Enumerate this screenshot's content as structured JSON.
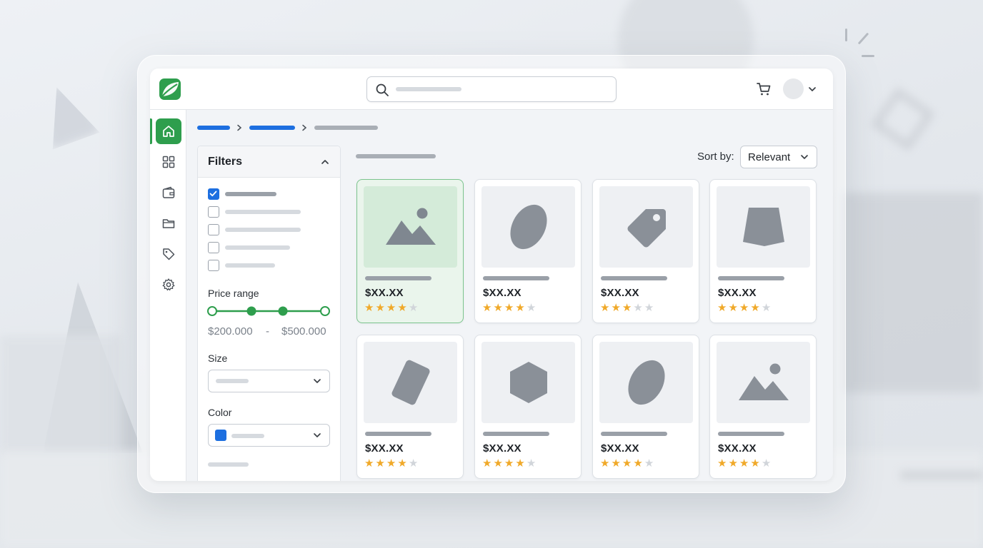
{
  "filters": {
    "title": "Filters",
    "checkboxes": [
      {
        "checked": true
      },
      {
        "checked": false
      },
      {
        "checked": false
      },
      {
        "checked": false
      },
      {
        "checked": false
      }
    ],
    "price_range": {
      "label": "Price range",
      "min": "$200.000",
      "separator": "-",
      "max": "$500.000"
    },
    "size": {
      "label": "Size"
    },
    "color": {
      "label": "Color",
      "swatch": "#1d6fe0"
    }
  },
  "sort": {
    "label": "Sort by:",
    "value": "Relevant"
  },
  "icons": {
    "sidebar": [
      "home-icon",
      "grid-icon",
      "wallet-icon",
      "folder-icon",
      "tag-icon",
      "gear-icon"
    ],
    "header": [
      "search-icon",
      "cart-icon",
      "chevron-down-icon"
    ]
  },
  "colors": {
    "brand": "#2e9e4d",
    "accent": "#1d6fe0",
    "star": "#f0a929"
  },
  "products": [
    {
      "price": "$XX.XX",
      "rating": 4,
      "shape": "image",
      "selected": true
    },
    {
      "price": "$XX.XX",
      "rating": 4,
      "shape": "oval"
    },
    {
      "price": "$XX.XX",
      "rating": 3,
      "shape": "tag"
    },
    {
      "price": "$XX.XX",
      "rating": 4,
      "shape": "trapezoid"
    },
    {
      "price": "$XX.XX",
      "rating": 4,
      "shape": "card"
    },
    {
      "price": "$XX.XX",
      "rating": 4,
      "shape": "hexagon"
    },
    {
      "price": "$XX.XX",
      "rating": 4,
      "shape": "oval"
    },
    {
      "price": "$XX.XX",
      "rating": 4,
      "shape": "image"
    }
  ]
}
